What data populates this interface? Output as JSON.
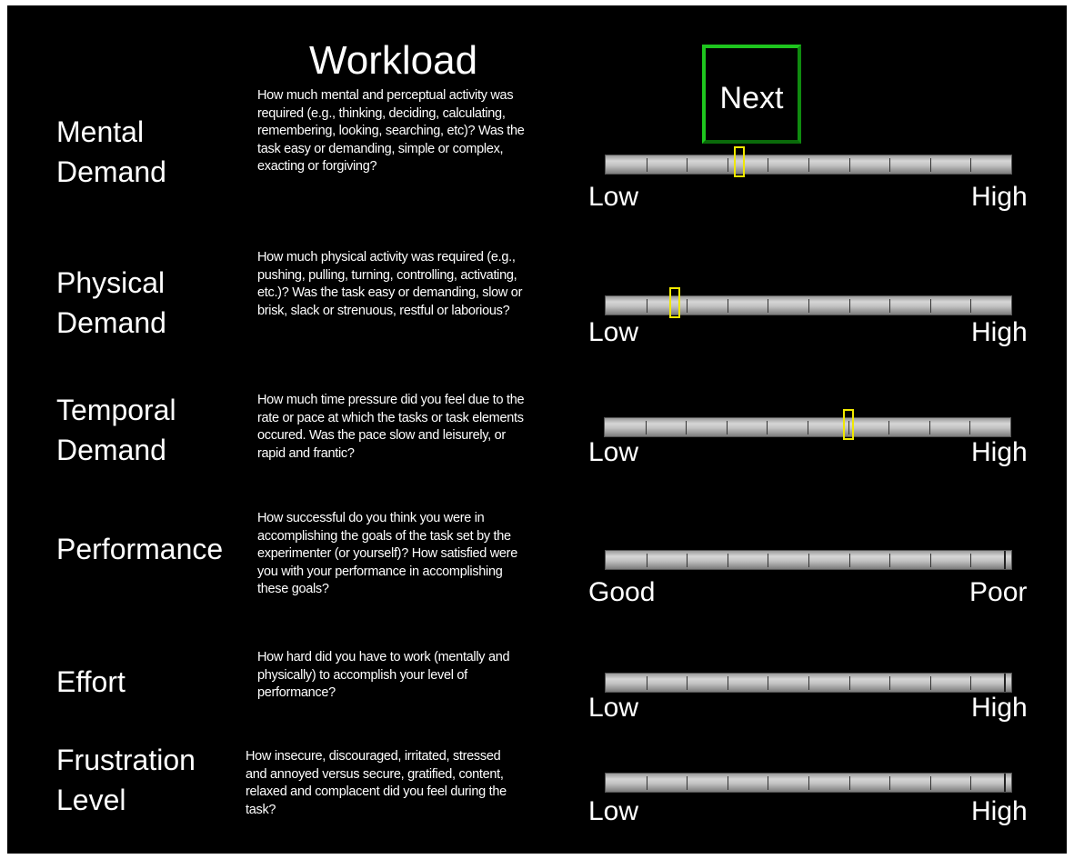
{
  "title": "Workload",
  "next_label": "Next",
  "colors": {
    "background": "#000000",
    "text": "#ffffff",
    "next_border": "#1ec51e",
    "marker": "#f0e800",
    "scale": "#c2c2c2"
  },
  "scales": [
    {
      "label_line1": "Mental",
      "label_line2": "Demand",
      "question": "How much mental and perceptual activity was required (e.g., thinking, deciding, calculating, remembering, looking, searching, etc)? Was the task easy or demanding, simple or complex, exacting or forgiving?",
      "low": "Low",
      "high": "High",
      "marker_value": 0.33
    },
    {
      "label_line1": "Physical",
      "label_line2": "Demand",
      "question": "How much physical activity was required (e.g., pushing, pulling, turning, controlling, activating, etc.)? Was the task easy or demanding, slow or brisk, slack or strenuous, restful or laborious?",
      "low": "Low",
      "high": "High",
      "marker_value": 0.17
    },
    {
      "label_line1": "Temporal",
      "label_line2": "Demand",
      "question": "How much time pressure did you feel due to the rate or pace at which the tasks or task elements occured. Was the pace slow and leisurely, or rapid and frantic?",
      "low": "Low",
      "high": "High",
      "marker_value": 0.6
    },
    {
      "label_line1": "Performance",
      "label_line2": "",
      "question": "How successful do you think you were in accomplishing the goals of the task set by the experimenter (or yourself)? How satisfied were you with your performance in accomplishing these goals?",
      "low": "Good",
      "high": "Poor",
      "marker_value": null
    },
    {
      "label_line1": "Effort",
      "label_line2": "",
      "question": "How hard did you have to work (mentally and physically) to accomplish your level of performance?",
      "low": "Low",
      "high": "High",
      "marker_value": null
    },
    {
      "label_line1": "Frustration",
      "label_line2": "Level",
      "question": "How insecure, discouraged, irritated, stressed and annoyed versus secure, gratified, content, relaxed and complacent did you feel during the task?",
      "low": "Low",
      "high": "High",
      "marker_value": null
    }
  ]
}
